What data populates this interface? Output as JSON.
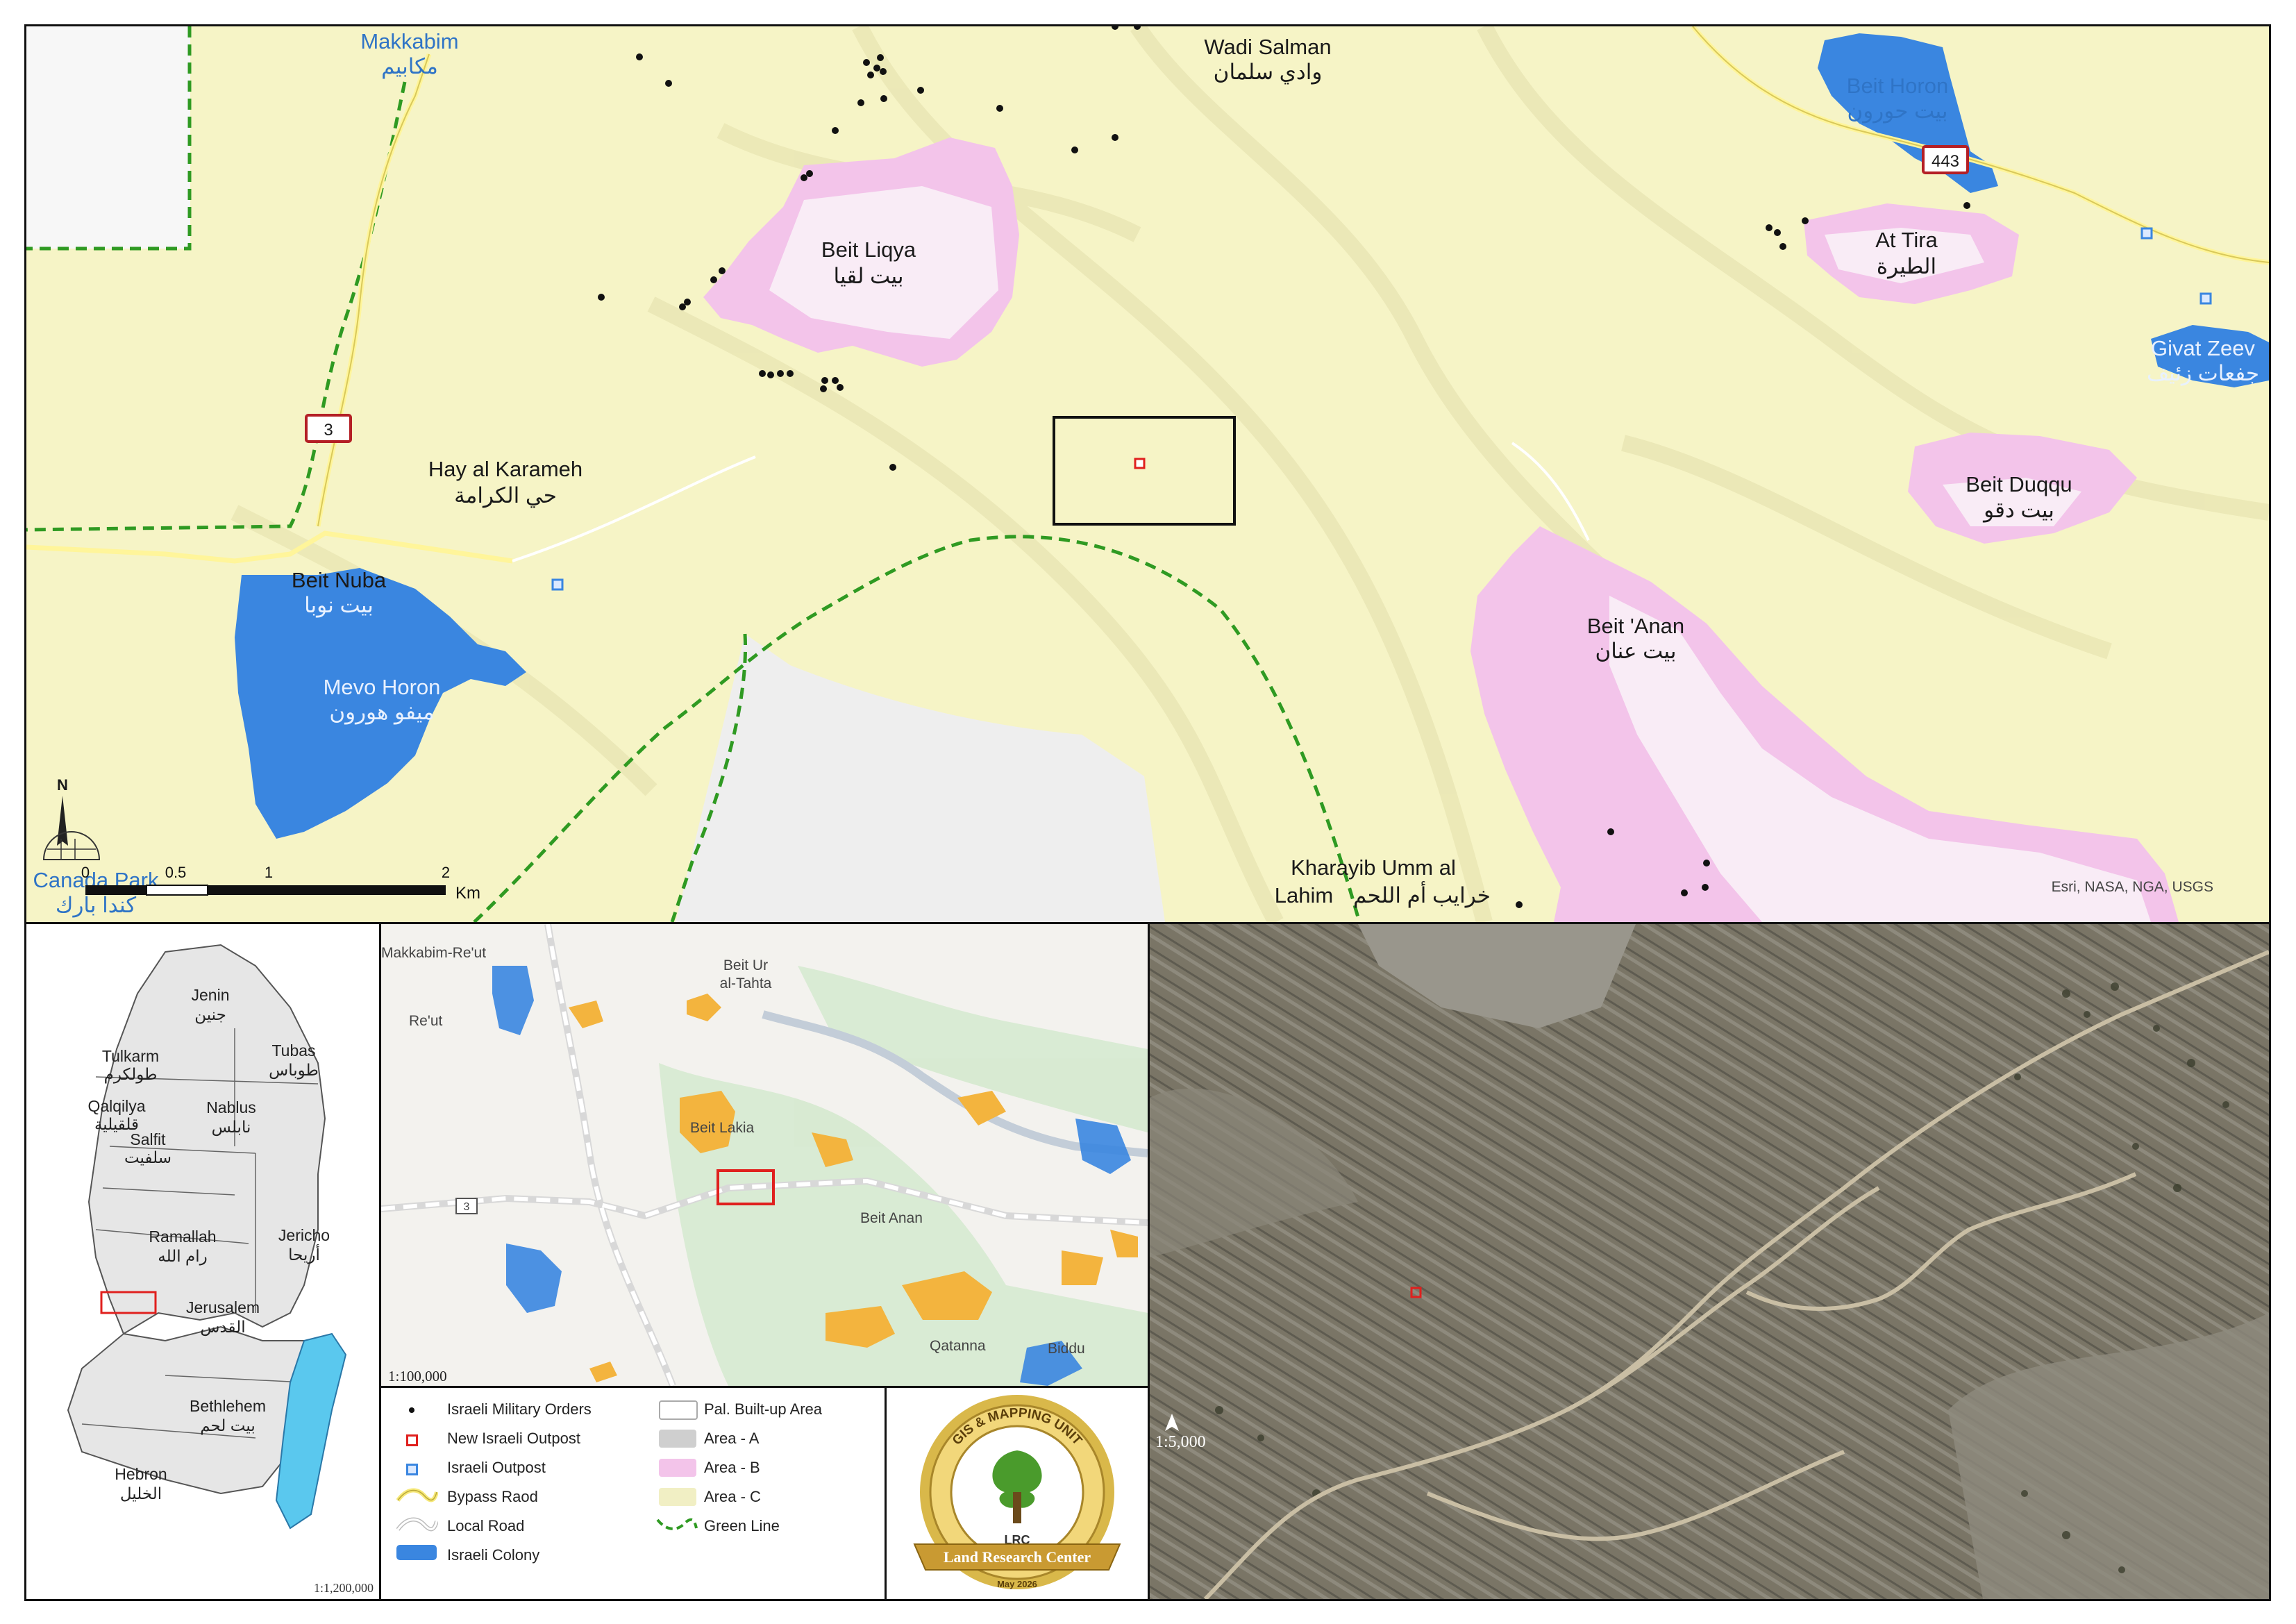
{
  "main_map": {
    "places": [
      {
        "name": "Makkabim",
        "arabic": "مكابيم"
      },
      {
        "name": "Wadi Salman",
        "arabic": "وادي سلمان"
      },
      {
        "name": "Beit Horon",
        "arabic": "بيت حورون"
      },
      {
        "name": "Beit Liqya",
        "arabic": "بيت لقيا"
      },
      {
        "name": "At Tira",
        "arabic": "الطيرة"
      },
      {
        "name": "Givat Zeev",
        "arabic": "جفعات زئيف"
      },
      {
        "name": "Hay al Karameh",
        "arabic": "حي الكرامة"
      },
      {
        "name": "Beit Duqqu",
        "arabic": "بيت دقو"
      },
      {
        "name": "Beit Nuba",
        "arabic": "بيت نوبا"
      },
      {
        "name": "Mevo Horon",
        "arabic": "ميفو هورون"
      },
      {
        "name": "Beit 'Anan",
        "arabic": "بيت عنان"
      },
      {
        "name": "Canada Park",
        "arabic": "كندا بارك"
      },
      {
        "name": "Kharayib Umm al",
        "name2": "Lahim",
        "arabic": "خرايب أم اللحم"
      }
    ],
    "road_shields": {
      "route_3": "3",
      "route_443": "443"
    },
    "scale_bar": {
      "ticks": [
        "0",
        "0.5",
        "1",
        "2"
      ],
      "unit": "Km"
    },
    "north_label": "N",
    "credit": "Esri, NASA, NGA, USGS"
  },
  "overview_map": {
    "governorates": [
      {
        "name": "Jenin",
        "arabic": "جنين"
      },
      {
        "name": "Tubas",
        "arabic": "طوباس"
      },
      {
        "name": "Tulkarm",
        "arabic": "طولكرم"
      },
      {
        "name": "Qalqilya",
        "arabic": "قلقيلية"
      },
      {
        "name": "Nablus",
        "arabic": "نابلس"
      },
      {
        "name": "Salfit",
        "arabic": "سلفيت"
      },
      {
        "name": "Ramallah",
        "arabic": "رام الله"
      },
      {
        "name": "Jericho",
        "arabic": "أريحا"
      },
      {
        "name": "Jerusalem",
        "arabic": "القدس"
      },
      {
        "name": "Bethlehem",
        "arabic": "بيت لحم"
      },
      {
        "name": "Hebron",
        "arabic": "الخليل"
      }
    ],
    "scale": "1:1,200,000"
  },
  "inset_map": {
    "labels": [
      "Makkabim-Re'ut",
      "Re'ut",
      "Beit Ur",
      "al-Tahta",
      "Beit Lakia",
      "Beit Anan",
      "Qatanna",
      "Biddu",
      "3"
    ],
    "scale": "1:100,000"
  },
  "legend": {
    "items": [
      {
        "label": "Israeli Military Orders",
        "symbol": "dot"
      },
      {
        "label": "New Israeli Outpost",
        "symbol": "red-square"
      },
      {
        "label": "Israeli Outpost",
        "symbol": "blue-square"
      },
      {
        "label": "Bypass Raod",
        "symbol": "yellow-line"
      },
      {
        "label": "Local Road",
        "symbol": "white-line"
      },
      {
        "label": "Israeli Colony",
        "symbol": "blue-fill"
      },
      {
        "label": "Pal. Built-up Area",
        "symbol": "white-fill"
      },
      {
        "label": "Area - A",
        "symbol": "grey-fill"
      },
      {
        "label": "Area - B",
        "symbol": "pink-fill"
      },
      {
        "label": "Area - C",
        "symbol": "cream-fill"
      },
      {
        "label": "Green Line",
        "symbol": "green-dash"
      }
    ]
  },
  "logo": {
    "top_text": "GIS & MAPPING UNIT",
    "initials": "LRC",
    "ribbon": "Land Research Center",
    "date": "May 2026"
  },
  "satellite": {
    "scale": "1:5,000"
  },
  "colors": {
    "area_c": "#f6f4c6",
    "area_b": "#f3c4ea",
    "colony": "#3a86e0",
    "green_line": "#2f9a22",
    "new_outpost": "#e0201e",
    "israeli_outpost": "#3a86e0"
  }
}
